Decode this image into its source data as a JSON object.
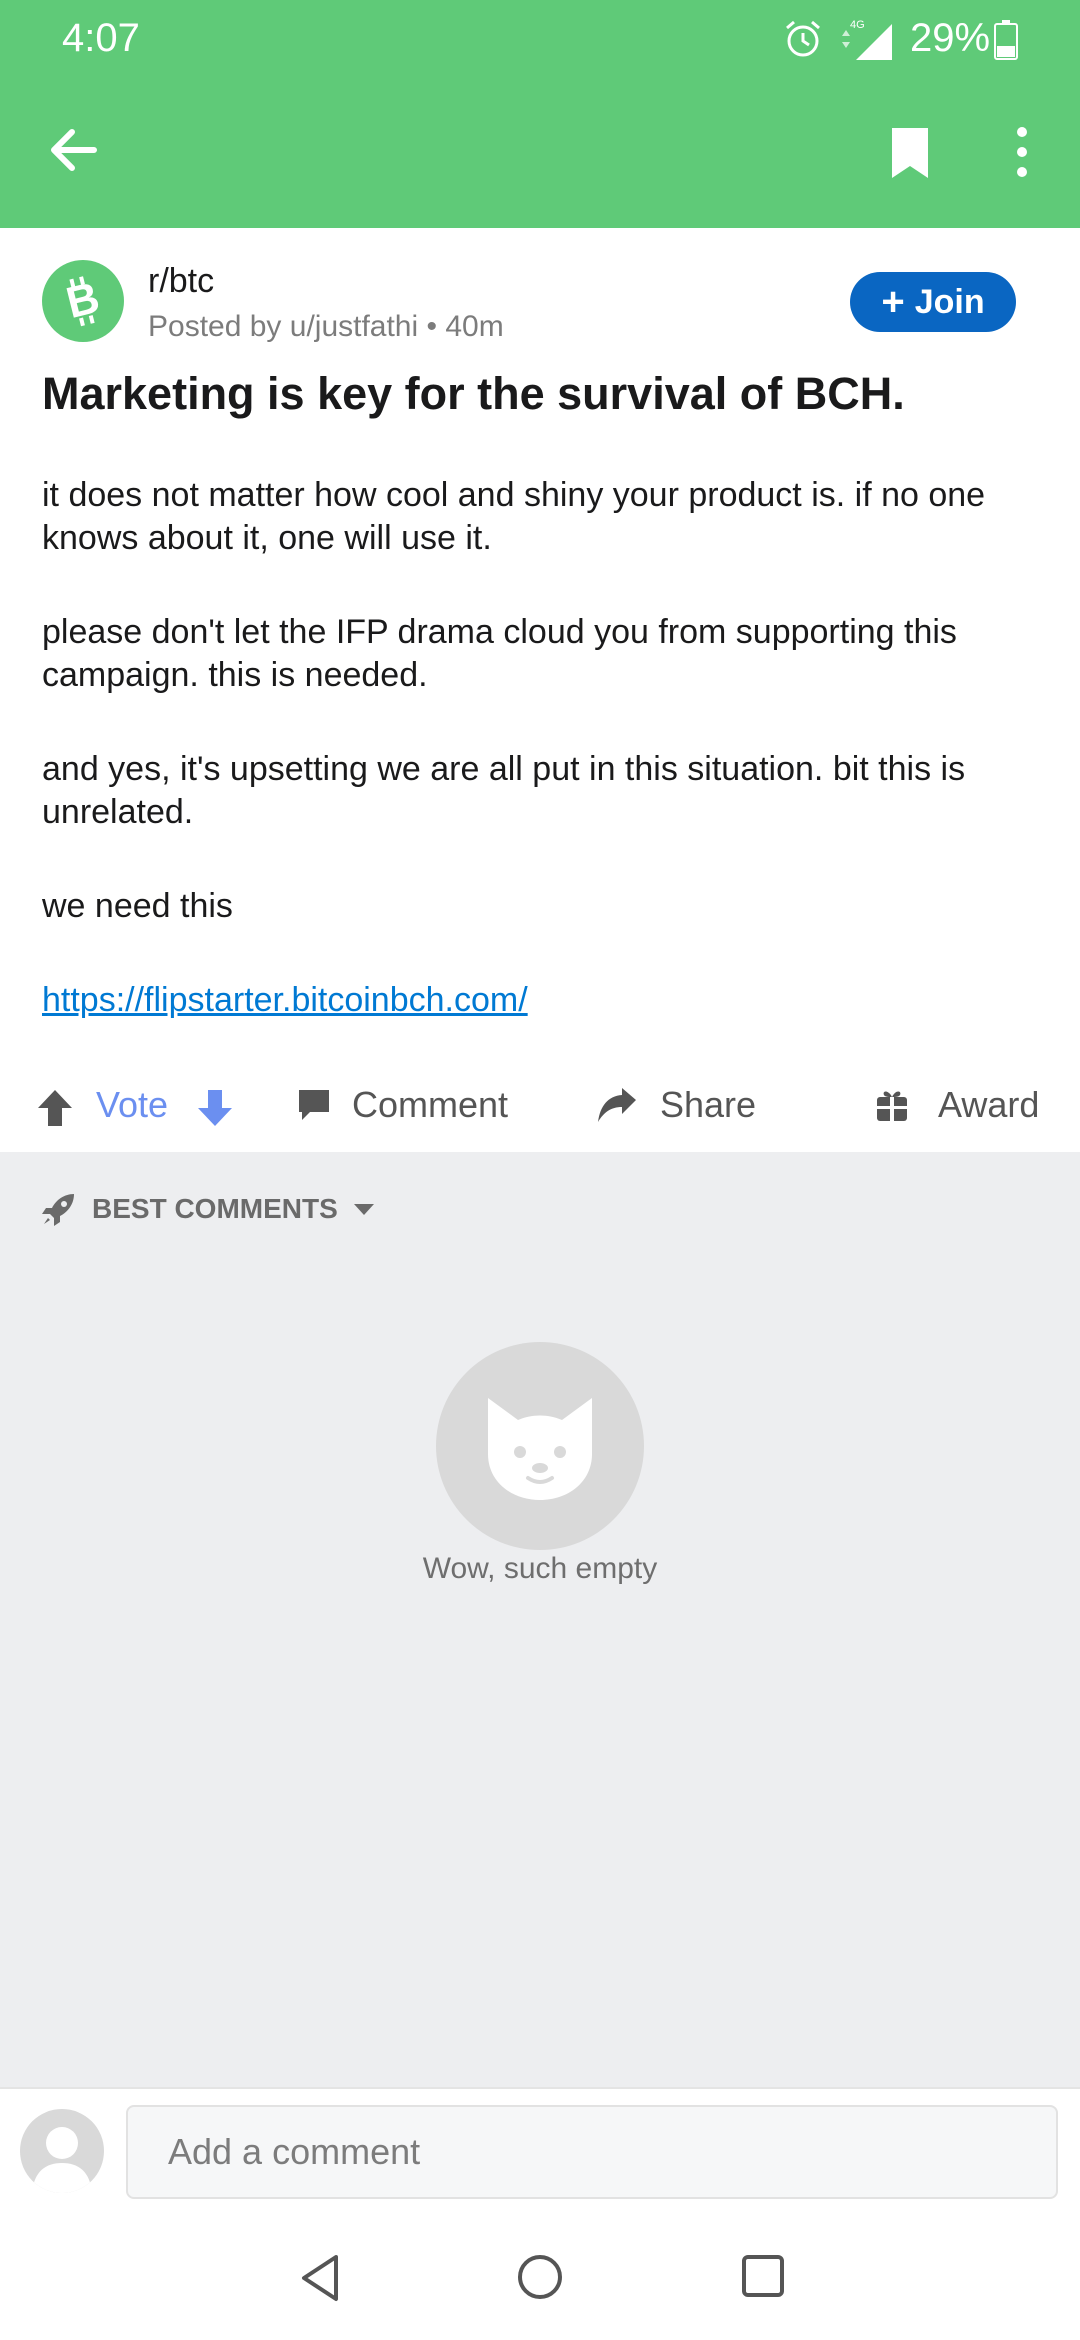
{
  "status_bar": {
    "time": "4:07",
    "network": "4G",
    "battery": "29%"
  },
  "post": {
    "subreddit": "r/btc",
    "meta": "Posted by u/justfathi • 40m",
    "join_label": "Join",
    "title": "Marketing is key for the survival of BCH.",
    "paragraphs": [
      "it does not matter how cool and shiny your product is. if no one knows about it, one will use it.",
      "please don't let the IFP drama cloud you from supporting this campaign. this is needed.",
      "and yes, it's upsetting we are all put in this situation. bit this is unrelated.",
      "we need this"
    ],
    "link": "https://flipstarter.bitcoinbch.com/"
  },
  "actions": {
    "vote": "Vote",
    "comment": "Comment",
    "share": "Share",
    "award": "Award"
  },
  "comments": {
    "sort_label": "BEST COMMENTS",
    "empty_text": "Wow, such empty"
  },
  "comment_bar": {
    "placeholder": "Add a comment"
  },
  "colors": {
    "brand_green": "#5fca78",
    "join_blue": "#0a66c2",
    "vote_blue": "#6b8ff0",
    "link": "#0079d3"
  }
}
